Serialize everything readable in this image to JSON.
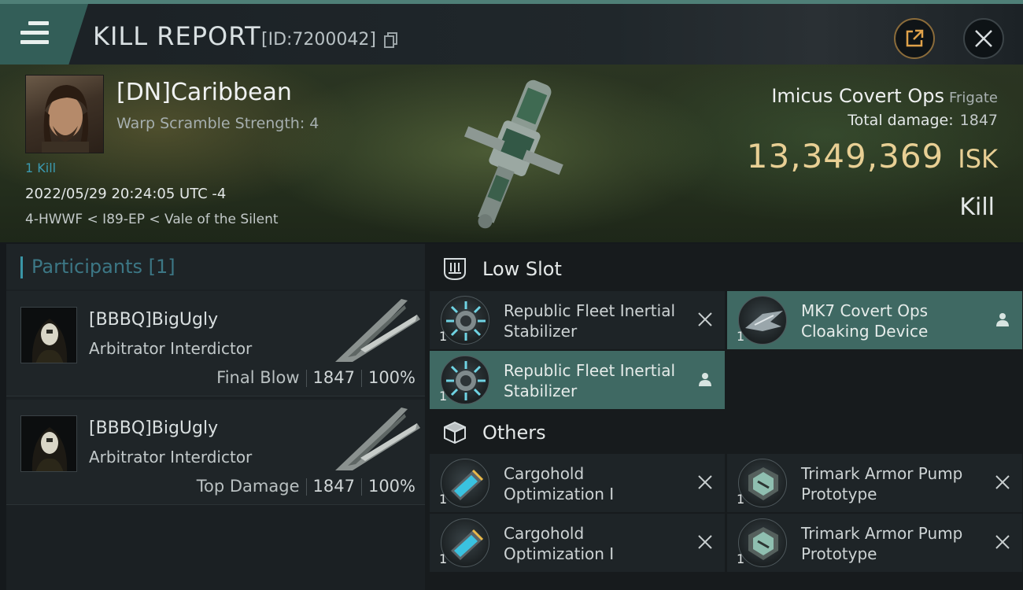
{
  "header": {
    "title": "KILL REPORT",
    "report_id": "[ID:7200042]"
  },
  "victim": {
    "pilot_name": "[DN]Caribbean",
    "warp_scramble": "Warp Scramble Strength: 4",
    "kills": "1 Kill",
    "datetime": "2022/05/29 20:24:05 UTC -4",
    "location": "4-HWWF < I89-EP < Vale of the Silent",
    "ship_name": "Imicus Covert Ops",
    "ship_class": "Frigate",
    "total_damage_label": "Total damage:",
    "total_damage_value": "1847",
    "isk_value": "13,349,369",
    "isk_unit": "ISK",
    "result": "Kill"
  },
  "participants": {
    "title": "Participants [1]",
    "rows": [
      {
        "name": "[BBBQ]BigUgly",
        "ship": "Arbitrator Interdictor",
        "role": "Final Blow",
        "damage": "1847",
        "percent": "100%"
      },
      {
        "name": "[BBBQ]BigUgly",
        "ship": "Arbitrator Interdictor",
        "role": "Top Damage",
        "damage": "1847",
        "percent": "100%"
      }
    ]
  },
  "modules": {
    "low_slot": {
      "title": "Low Slot",
      "items": [
        {
          "name_line1": "Republic Fleet Inertial",
          "name_line2": "Stabilizer",
          "qty": "1",
          "status": "destroyed"
        },
        {
          "name_line1": "MK7 Covert Ops",
          "name_line2": "Cloaking Device",
          "qty": "1",
          "status": "dropped"
        },
        {
          "name_line1": "Republic Fleet Inertial",
          "name_line2": "Stabilizer",
          "qty": "1",
          "status": "dropped"
        }
      ]
    },
    "others": {
      "title": "Others",
      "items": [
        {
          "name_line1": "Cargohold",
          "name_line2": "Optimization I",
          "qty": "1",
          "status": "destroyed"
        },
        {
          "name_line1": "Trimark Armor Pump",
          "name_line2": "Prototype",
          "qty": "1",
          "status": "destroyed"
        },
        {
          "name_line1": "Cargohold",
          "name_line2": "Optimization I",
          "qty": "1",
          "status": "destroyed"
        },
        {
          "name_line1": "Trimark Armor Pump",
          "name_line2": "Prototype",
          "qty": "1",
          "status": "destroyed"
        }
      ]
    }
  },
  "colors": {
    "accent_teal": "#335e58",
    "active_row": "#3f6963",
    "isk_gold": "#e8cf94",
    "kills_blue": "#3b9ab0"
  }
}
